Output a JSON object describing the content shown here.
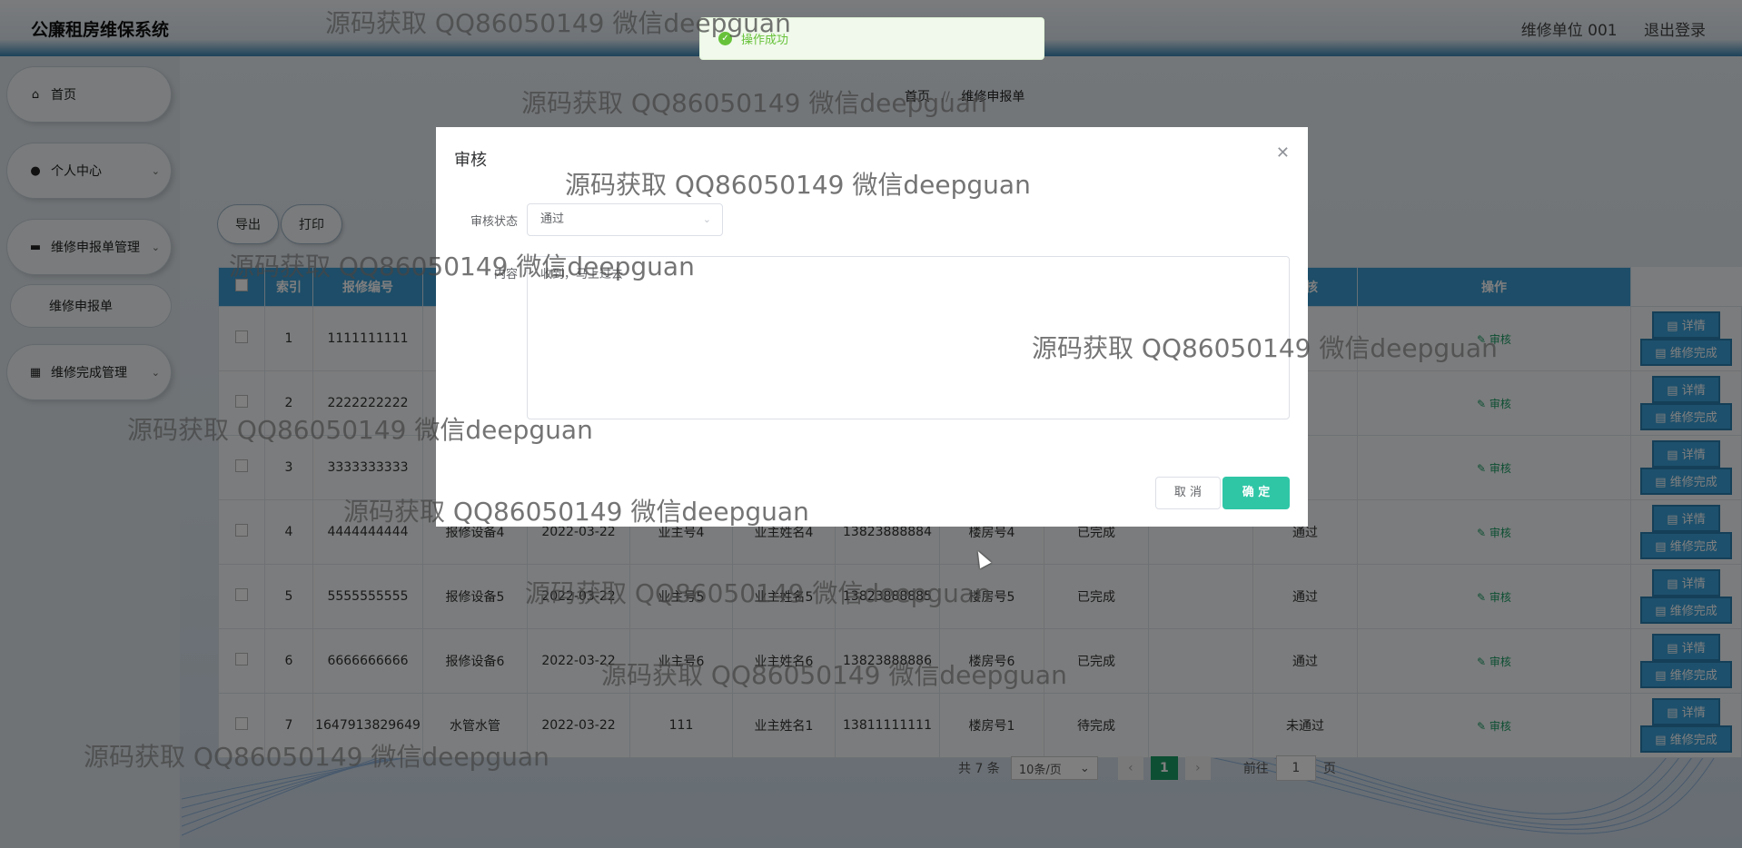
{
  "app": {
    "title": "公廉租房维保系统"
  },
  "header": {
    "user": "维修单位 001",
    "logout": "退出登录"
  },
  "sidebar": {
    "items": [
      {
        "label": "首页",
        "icon": "home-icon"
      },
      {
        "label": "个人中心",
        "icon": "user-icon"
      },
      {
        "label": "维修申报单管理",
        "icon": "chat-icon"
      },
      {
        "label": "维修申报单",
        "icon": ""
      },
      {
        "label": "维修完成管理",
        "icon": "grid-icon"
      }
    ]
  },
  "breadcrumb": {
    "home": "首页",
    "separator": "//",
    "current": "维修申报单"
  },
  "toolbar": {
    "export_label": "导出",
    "print_label": "打印"
  },
  "table": {
    "headers": [
      "索引",
      "报修编号",
      "",
      "",
      "",
      "",
      "",
      "",
      "",
      "",
      "审核",
      "操作"
    ],
    "rows": [
      {
        "index": "1",
        "code": "1111111111",
        "device": "",
        "date": "",
        "owner_no": "",
        "owner_name": "",
        "phone": "",
        "building": "",
        "status": "",
        "reply": "",
        "audit": ""
      },
      {
        "index": "2",
        "code": "2222222222",
        "device": "",
        "date": "",
        "owner_no": "",
        "owner_name": "",
        "phone": "",
        "building": "",
        "status": "",
        "reply": "",
        "audit": ""
      },
      {
        "index": "3",
        "code": "3333333333",
        "device": "",
        "date": "",
        "owner_no": "",
        "owner_name": "",
        "phone": "",
        "building": "",
        "status": "",
        "reply": "",
        "audit": ""
      },
      {
        "index": "4",
        "code": "4444444444",
        "device": "报修设备4",
        "date": "2022-03-22",
        "owner_no": "业主号4",
        "owner_name": "业主姓名4",
        "phone": "13823888884",
        "building": "楼房号4",
        "status": "已完成",
        "reply": "",
        "audit": "通过"
      },
      {
        "index": "5",
        "code": "5555555555",
        "device": "报修设备5",
        "date": "2022-03-22",
        "owner_no": "业主号5",
        "owner_name": "业主姓名5",
        "phone": "13823888885",
        "building": "楼房号5",
        "status": "已完成",
        "reply": "",
        "audit": "通过"
      },
      {
        "index": "6",
        "code": "6666666666",
        "device": "报修设备6",
        "date": "2022-03-22",
        "owner_no": "业主号6",
        "owner_name": "业主姓名6",
        "phone": "13823888886",
        "building": "楼房号6",
        "status": "已完成",
        "reply": "",
        "audit": "通过"
      },
      {
        "index": "7",
        "code": "1647913829649",
        "device": "水管水管",
        "date": "2022-03-22",
        "owner_no": "111",
        "owner_name": "业主姓名1",
        "phone": "13811111111",
        "building": "楼房号1",
        "status": "待完成",
        "reply": "",
        "audit": "未通过"
      }
    ],
    "audit_link": "审核",
    "detail_label": "详情",
    "complete_label": "维修完成"
  },
  "pager": {
    "total": "共 7 条",
    "page_size": "10条/页",
    "current": "1",
    "goto": "前往",
    "goto_value": "1",
    "unit": "页"
  },
  "toast": {
    "message": "操作成功"
  },
  "dialog": {
    "title": "审核",
    "status_label": "审核状态",
    "status_value": "通过",
    "content_label": "内容",
    "content_value": "收到，马上过去",
    "cancel_label": "取 消",
    "ok_label": "确 定"
  },
  "watermark": {
    "text": "源码获取 QQ86050149 微信deepguan"
  }
}
